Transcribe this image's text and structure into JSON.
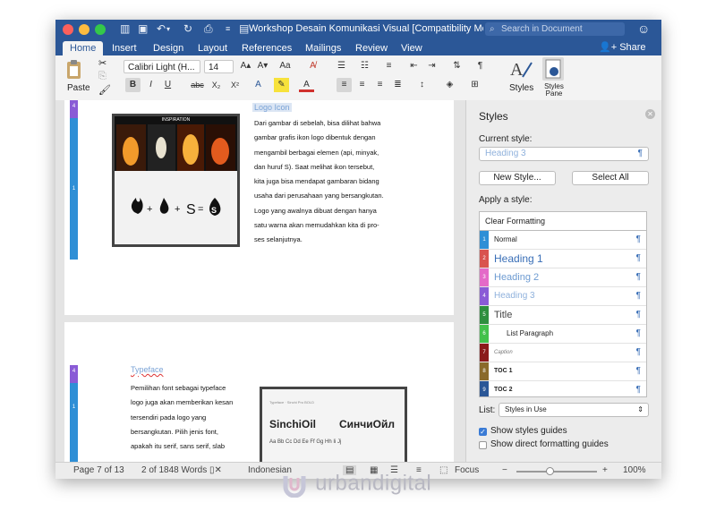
{
  "window": {
    "title": "Workshop Desain Komunikasi Visual [Compatibility Mo...",
    "search_placeholder": "Search in Document",
    "share_label": "Share"
  },
  "tabs": [
    "Home",
    "Insert",
    "Design",
    "Layout",
    "References",
    "Mailings",
    "Review",
    "View"
  ],
  "ribbon": {
    "paste_label": "Paste",
    "font_name": "Calibri Light (H...",
    "font_size": "14",
    "styles_label": "Styles",
    "styles_pane_label": "Styles Pane"
  },
  "page1": {
    "heading": "Logo Icon",
    "image_caption": "INSPIRATION",
    "equation": "= S",
    "body_lines": [
      "Dari gambar di sebelah, bisa dilihat bahwa",
      "gambar grafis ikon logo dibentuk dengan",
      "mengambil berbagai elemen (api, minyak,",
      "dan huruf S). Saat melihat ikon tersebut,",
      "kita juga bisa mendapat gambaran bidang",
      "usaha dari perusahaan yang bersangkutan.",
      "Logo yang awalnya dibuat dengan hanya",
      "satu warna akan memudahkan kita di pro-",
      "ses selanjutnya."
    ],
    "bar_numbers": [
      "4",
      "1"
    ]
  },
  "page2": {
    "heading": "Typeface",
    "body_lines": [
      "Pemilihan font sebagai typeface",
      "logo juga akan memberikan kesan",
      "tersendiri pada logo yang",
      "bersangkutan. Pilih jenis font,",
      "apakah itu serif, sans serif, slab"
    ],
    "sample_header": "Typeface · Sinchi Pro BOLD",
    "sample_latin": "SinchiOil",
    "sample_cyrillic": "СинчиОйл",
    "sample_small": "Aa Bb Cc Dd Ee Ff Gg Hh Ii Jj",
    "bar_numbers": [
      "4",
      "1"
    ]
  },
  "styles_pane": {
    "title": "Styles",
    "current_style_label": "Current style:",
    "current_style_value": "Heading 3",
    "new_style_label": "New Style...",
    "select_all_label": "Select All",
    "apply_label": "Apply a style:",
    "styles": [
      {
        "name": "Clear Formatting",
        "num": "",
        "color": "#ffffff",
        "text_color": "#222222",
        "size": "9px",
        "weight": "normal"
      },
      {
        "name": "Normal",
        "num": "1",
        "color": "#2f8fd6",
        "text_color": "#222222",
        "size": "8px",
        "weight": "normal"
      },
      {
        "name": "Heading 1",
        "num": "2",
        "color": "#d9534f",
        "text_color": "#3a6fb7",
        "size": "12px",
        "weight": "normal"
      },
      {
        "name": "Heading 2",
        "num": "3",
        "color": "#e46ac8",
        "text_color": "#6d9bd2",
        "size": "11px",
        "weight": "normal"
      },
      {
        "name": "Heading 3",
        "num": "4",
        "color": "#8a5bd6",
        "text_color": "#8fb1dc",
        "size": "10px",
        "weight": "normal"
      },
      {
        "name": "Title",
        "num": "5",
        "color": "#2f8f3f",
        "text_color": "#444444",
        "size": "11px",
        "weight": "normal"
      },
      {
        "name": "List Paragraph",
        "num": "6",
        "color": "#43c14b",
        "text_color": "#222222",
        "size": "8px",
        "weight": "normal"
      },
      {
        "name": "Caption",
        "num": "7",
        "color": "#8b1a1a",
        "text_color": "#777777",
        "size": "6px",
        "weight": "normal"
      },
      {
        "name": "TOC 1",
        "num": "8",
        "color": "#8a6a2a",
        "text_color": "#222222",
        "size": "7px",
        "weight": "bold"
      },
      {
        "name": "TOC 2",
        "num": "9",
        "color": "#2b5797",
        "text_color": "#222222",
        "size": "7px",
        "weight": "bold"
      }
    ],
    "list_label": "List:",
    "list_value": "Styles in Use",
    "show_styles_guides": "Show styles guides",
    "show_direct_formatting": "Show direct formatting guides"
  },
  "status": {
    "page": "Page 7 of 13",
    "words": "2 of 1848 Words",
    "language": "Indonesian",
    "focus": "Focus",
    "zoom": "100%"
  },
  "watermark": "urbandigital"
}
